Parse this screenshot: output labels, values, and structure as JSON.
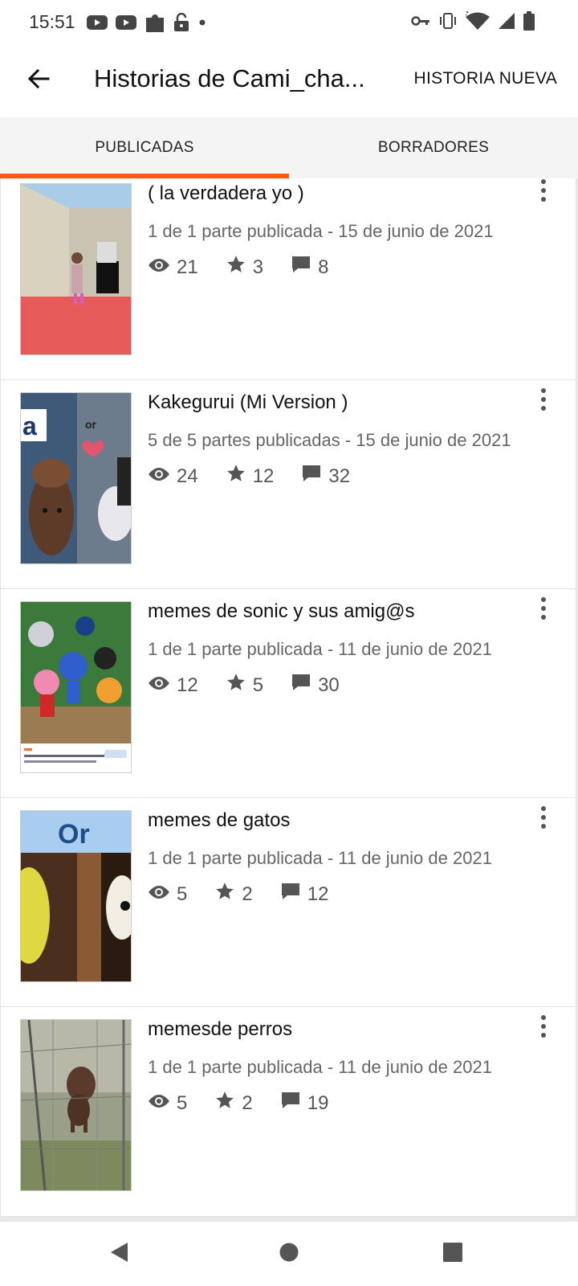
{
  "status_bar": {
    "time": "15:51",
    "left_icons": [
      "youtube-icon",
      "youtube-icon",
      "puzzle-icon",
      "unlock-icon",
      "dot-icon"
    ],
    "right_icons": [
      "key-icon",
      "vibrate-icon",
      "wifi-icon",
      "signal-icon",
      "battery-icon"
    ]
  },
  "app_bar": {
    "title": "Historias de Cami_cha...",
    "action_label": "HISTORIA NUEVA"
  },
  "tabs": [
    {
      "label": "PUBLICADAS",
      "selected": true
    },
    {
      "label": "BORRADORES",
      "selected": false
    }
  ],
  "accent_color": "#ff5a14",
  "stories": [
    {
      "title": "( la verdadera yo )",
      "meta": "1 de 1 parte publicada - 15 de junio de 2021",
      "reads": "21",
      "votes": "3",
      "comments": "8"
    },
    {
      "title": "Kakegurui (Mi Version )",
      "meta": "5 de 5 partes publicadas - 15 de junio de 2021",
      "reads": "24",
      "votes": "12",
      "comments": "32"
    },
    {
      "title": "memes de sonic y sus amig@s",
      "meta": "1 de 1 parte publicada - 11 de junio de 2021",
      "reads": "12",
      "votes": "5",
      "comments": "30"
    },
    {
      "title": "memes de gatos",
      "meta": "1 de 1 parte publicada - 11 de junio de 2021",
      "reads": "5",
      "votes": "2",
      "comments": "12"
    },
    {
      "title": "memesde perros",
      "meta": "1 de 1 parte publicada - 11 de junio de 2021",
      "reads": "5",
      "votes": "2",
      "comments": "19"
    }
  ],
  "cover_texts": {
    "kakegurui_a": "a",
    "kakegurui_or": "or",
    "gatos_or": "Or"
  },
  "nav_bar": [
    "back-triangle-icon",
    "home-circle-icon",
    "recents-square-icon"
  ]
}
